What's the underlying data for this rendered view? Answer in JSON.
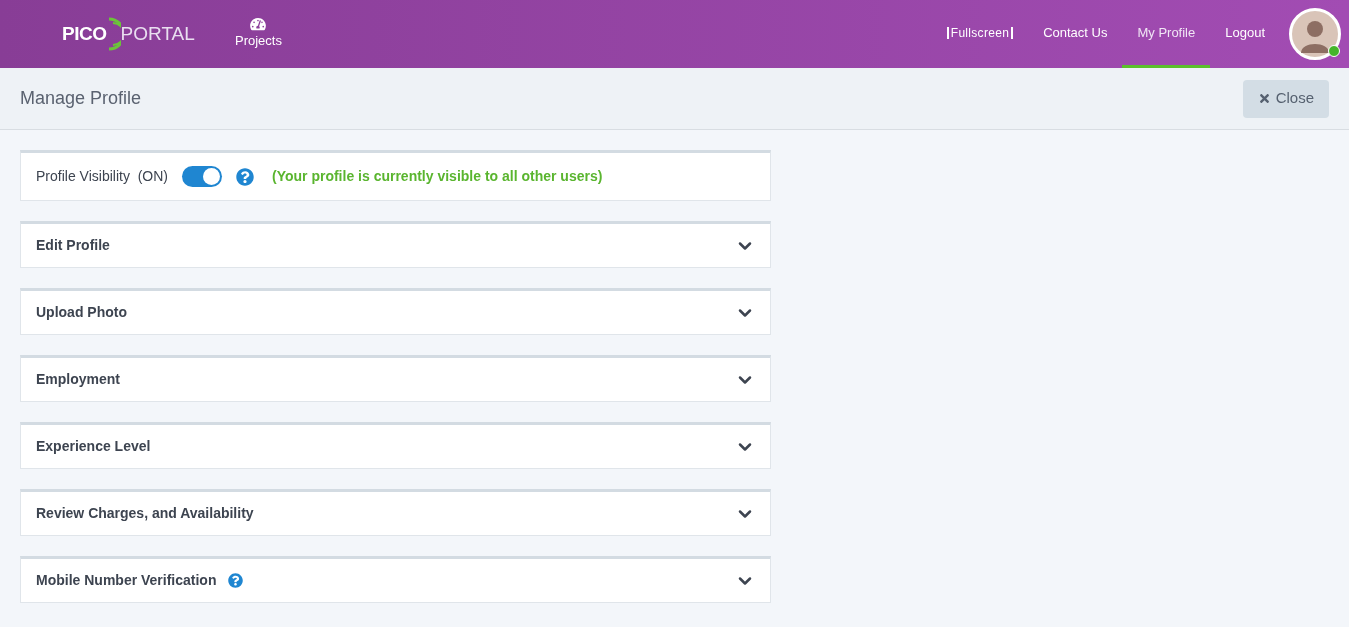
{
  "header": {
    "logo": {
      "left": "PICO",
      "right": "PORTAL"
    },
    "nav_left": [
      {
        "label": "Projects",
        "selected": false
      }
    ],
    "nav_right": [
      {
        "label": "Fullscreen",
        "kind": "fullscreen",
        "selected": false
      },
      {
        "label": "Contact Us",
        "kind": "link",
        "selected": false
      },
      {
        "label": "My Profile",
        "kind": "link",
        "selected": true
      },
      {
        "label": "Logout",
        "kind": "link",
        "selected": false
      }
    ],
    "avatar": {
      "online": true
    }
  },
  "page": {
    "title": "Manage Profile",
    "close_button": "Close"
  },
  "visibility": {
    "label": "Profile Visibility",
    "state_text": "(ON)",
    "on": true,
    "message": "(Your profile is currently visible to all other users)"
  },
  "sections": [
    {
      "title": "Edit Profile",
      "expanded": false,
      "help": false
    },
    {
      "title": "Upload Photo",
      "expanded": false,
      "help": false
    },
    {
      "title": "Employment",
      "expanded": false,
      "help": false
    },
    {
      "title": "Experience Level",
      "expanded": false,
      "help": false
    },
    {
      "title": "Review Charges, and Availability",
      "expanded": false,
      "help": false
    },
    {
      "title": "Mobile Number Verification",
      "expanded": false,
      "help": true
    }
  ]
}
